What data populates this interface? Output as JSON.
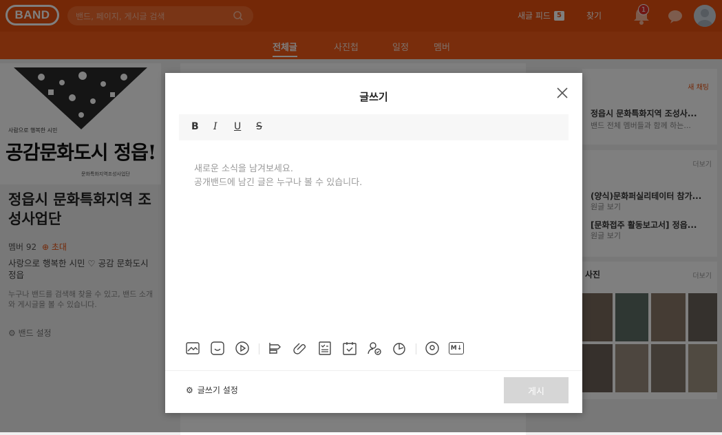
{
  "header": {
    "logo": "BAND",
    "search_placeholder": "밴드, 페이지, 게시글 검색",
    "new_feed_label": "새글 피드",
    "new_feed_count": "5",
    "find_label": "찾기",
    "notification_count": "1"
  },
  "tabs": [
    {
      "label": "전체글",
      "active": true
    },
    {
      "label": "사진첩",
      "active": false
    },
    {
      "label": "일정",
      "active": false
    },
    {
      "label": "멤버",
      "active": false
    }
  ],
  "band": {
    "cover_tagline": "사람으로 행복한 시민",
    "cover_title": "공감문화도시 정읍!",
    "cover_footer": "문화특화지역조성사업단",
    "name": "정읍시 문화특화지역 조성사업단",
    "members_label": "멤버 92",
    "invite_label": "초대",
    "description": "사랑으로 행복한 시민 ♡ 공감 문화도시 정읍",
    "visibility_note": "누구나 밴드를 검색해 찾을 수 있고, 밴드 소개와 게시글을 볼 수 있습니다.",
    "settings_label": "밴드 설정"
  },
  "right": {
    "new_chat": "새 채팅",
    "chat_title": "정읍시 문화특화지역 조성사...",
    "chat_sub": "밴드 전체 멤버들과 함께 하는...",
    "more": "더보기",
    "notices": [
      {
        "title": "(양식)문화퍼실리테이터 참가...",
        "sub": "원글 보기"
      },
      {
        "title": "[문화접주 활동보고서] 정읍...",
        "sub": "원글 보기"
      }
    ],
    "photos_label": "사진"
  },
  "modal": {
    "title": "글쓰기",
    "placeholder_line1": "새로운 소식을 남겨보세요.",
    "placeholder_line2": "공개밴드에 남긴 글은 누구나 볼 수 있습니다.",
    "format_buttons": [
      "B",
      "I",
      "U",
      "S"
    ],
    "settings_label": "글쓰기 설정",
    "post_button": "게시",
    "toolbar_icons": [
      "image-icon",
      "sticker-icon",
      "video-icon",
      "text-align-icon",
      "attachment-icon",
      "checklist-icon",
      "schedule-icon",
      "vote-user-icon",
      "timer-icon",
      "location-icon",
      "markdown-icon"
    ],
    "markdown_label": "M↓"
  },
  "colors": {
    "brand": "#e8500f",
    "tabbar": "#f25a18",
    "post_disabled": "#d6d6d6"
  }
}
